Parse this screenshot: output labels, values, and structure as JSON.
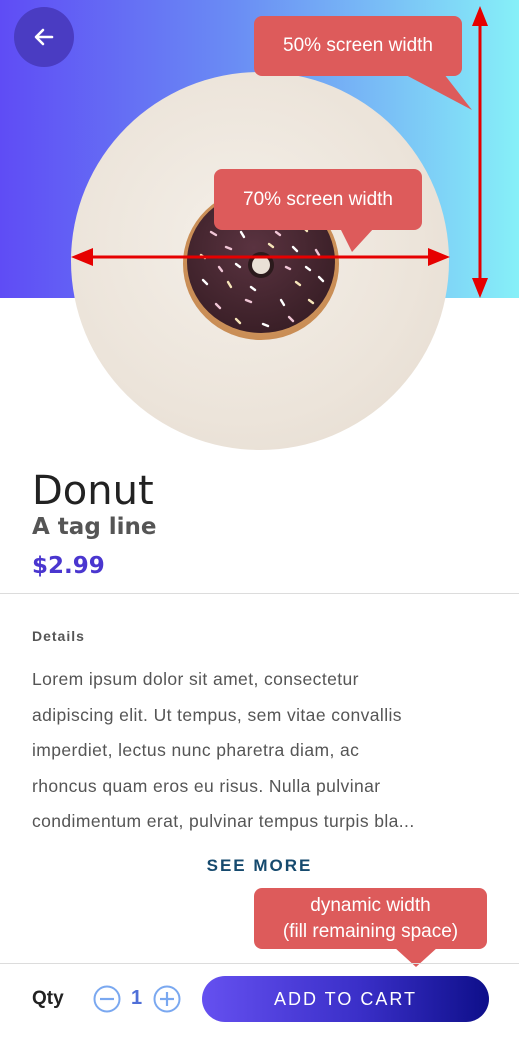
{
  "annotations": {
    "top_right": "50% screen width",
    "middle": "70% screen width",
    "bottom_line1": "dynamic width",
    "bottom_line2": "(fill remaining space)"
  },
  "product": {
    "name": "Donut",
    "tagline": "A tag line",
    "price": "$2.99"
  },
  "details": {
    "label": "Details",
    "lines": [
      "Lorem ipsum dolor sit amet, consectetur",
      "adipiscing elit. Ut tempus, sem vitae convallis",
      "imperdiet, lectus nunc pharetra diam, ac",
      "rhoncus quam eros eu risus. Nulla pulvinar",
      "condimentum erat, pulvinar tempus turpis bla..."
    ],
    "see_more": "SEE MORE"
  },
  "footer": {
    "qty_label": "Qty",
    "qty_value": "1",
    "add_to_cart": "ADD TO CART"
  },
  "icons": {
    "back": "arrow-left-icon",
    "minus": "minus-circle-icon",
    "plus": "plus-circle-icon"
  },
  "colors": {
    "accent": "#4a36cf",
    "annotation": "#dd5b5b",
    "annotation_arrow": "#e60000"
  }
}
